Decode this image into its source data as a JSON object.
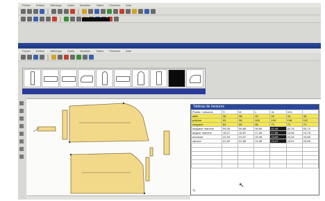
{
  "window": {
    "title": ""
  },
  "menu": {
    "items": [
      "Fichier",
      "Edition",
      "Affichage",
      "Outils",
      "Modèles",
      "Tailles",
      "Fenêtres",
      "Aide"
    ]
  },
  "submenu": {
    "items": [
      "Fichier",
      "Edition",
      "Affichage",
      "Outils",
      "Modèles",
      "Tailles",
      "Fenêtres",
      "Aide"
    ]
  },
  "spec_table": {
    "title": "Tableau de mesures",
    "header": [
      "Points / mesures",
      "S",
      "M",
      "L",
      "XL",
      "XXL",
      ""
    ],
    "rows": [
      {
        "label": "taille",
        "cells": [
          "36",
          "38",
          "40",
          "42",
          "44",
          "46"
        ],
        "highlight": "yellow"
      },
      {
        "label": "poitrine",
        "cells": [
          "92",
          "96",
          "100",
          "104",
          "108",
          "112"
        ],
        "highlight": "yellow"
      },
      {
        "label": "longueur",
        "cells": [
          "64",
          "66",
          "68",
          "70",
          "72",
          "74"
        ],
        "highlight": "yellow"
      },
      {
        "label": "longueur manche",
        "cells": [
          "59,28",
          "59,86",
          "59,96",
          "61,98",
          "62,78",
          "63,74"
        ],
        "highlight": "none"
      },
      {
        "label": "largeur manche",
        "cells": [
          "15,27",
          "16,87",
          "17,06",
          "17,86",
          "18,96",
          "19,78"
        ],
        "highlight": "none"
      },
      {
        "label": "encolure",
        "cells": [
          "22,94",
          "23,37",
          "23,46",
          "23,89",
          "24,34",
          "24,65"
        ],
        "highlight": "none"
      },
      {
        "label": "carrure",
        "cells": [
          "21,32",
          "21,85",
          "21,96",
          "22,47",
          "23,01",
          "23,55"
        ],
        "highlight": "none"
      }
    ],
    "highlighted_column": 4,
    "footer_label": "TL"
  },
  "colors": {
    "pattern_fill": "#f2d98a",
    "pattern_stroke": "#8a7440",
    "highlight_yellow": "#f5e84a",
    "selection_blue": "#2a3a9a"
  }
}
